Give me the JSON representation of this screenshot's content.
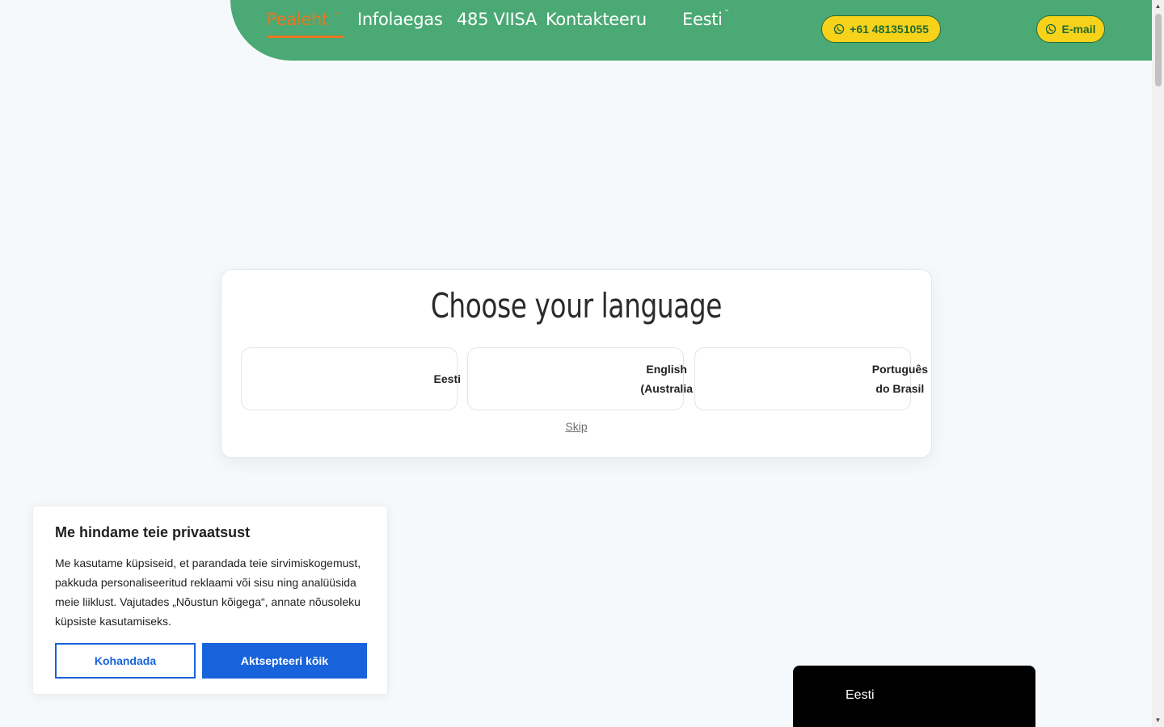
{
  "header": {
    "nav": [
      {
        "label": "Pealeht",
        "active": true,
        "has_dropdown": true
      },
      {
        "label": "Infolaegas",
        "active": false,
        "has_dropdown": false
      },
      {
        "label": "485 VIISA",
        "active": false,
        "has_dropdown": false
      },
      {
        "label": "Kontakteeru",
        "active": false,
        "has_dropdown": false
      }
    ],
    "language_selector": {
      "label": "Eesti",
      "icon": "chevron-down-icon"
    },
    "phone_button": {
      "label": "+61 481351055",
      "icon": "whatsapp-icon"
    },
    "email_button": {
      "label": "E-mail",
      "icon": "whatsapp-icon"
    },
    "colors": {
      "bar": "#4aa974",
      "active": "#e87722",
      "pill": "#f7d21b"
    }
  },
  "language_modal": {
    "title": "Choose your language",
    "options": [
      {
        "label": "Eesti"
      },
      {
        "label": "English\n(Australia"
      },
      {
        "label": "Português\ndo Brasil"
      }
    ],
    "skip": "Skip"
  },
  "cookie_banner": {
    "title": "Me hindame teie privaatsust",
    "text": "Me kasutame küpsiseid, et parandada teie sirvimiskogemust, pakkuda personaliseeritud reklaami või sisu ning analüüsida meie liiklust. Vajutades „Nõustun kõigega“, annate nõusoleku küpsiste kasutamiseks.",
    "customize_button": "Kohandada",
    "accept_button": "Aktsepteeri kõik",
    "colors": {
      "primary": "#1863dc"
    }
  },
  "language_widget": {
    "label": "Eesti"
  }
}
